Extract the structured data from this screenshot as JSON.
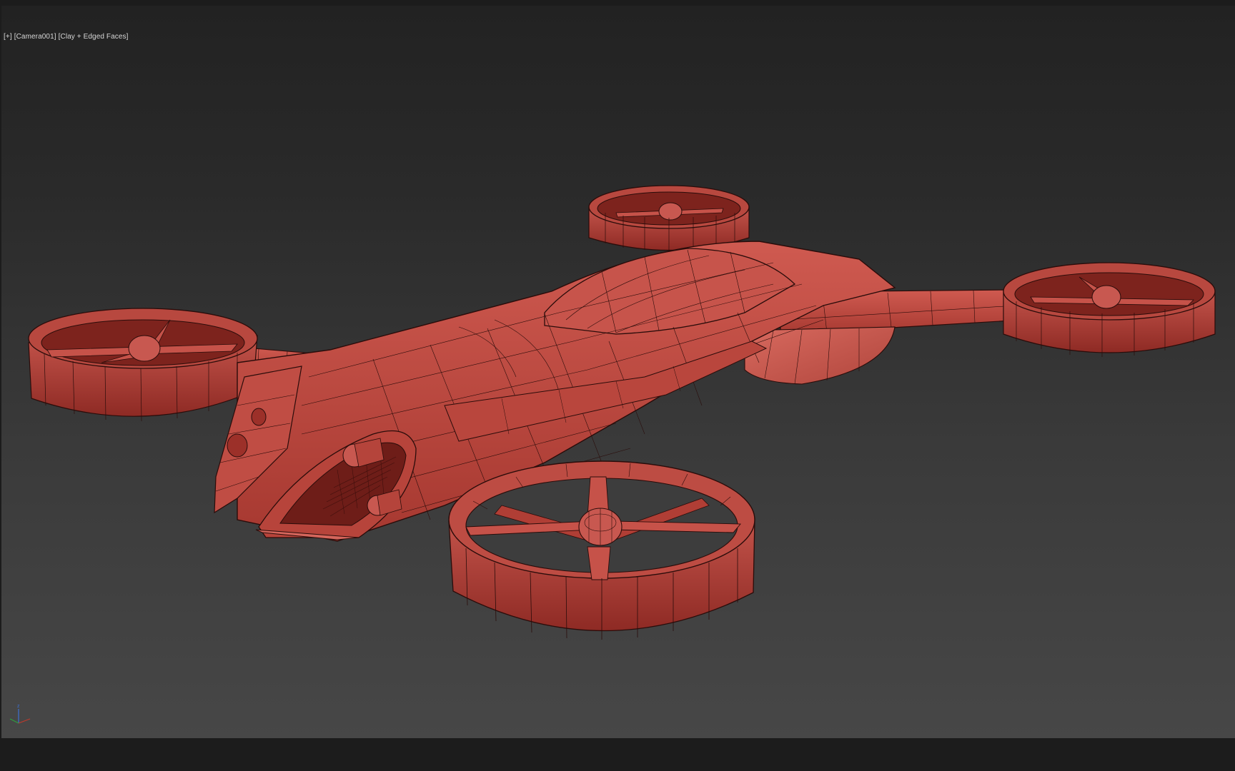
{
  "viewport": {
    "label_plus": "[+]",
    "label_camera": "[Camera001]",
    "label_shading": "[Clay + Edged Faces]"
  },
  "scene": {
    "object": "drone-model",
    "clay_color": "#b5433b",
    "wire_color": "#2a0c0a",
    "background_top": "#222222",
    "background_bottom": "#474747"
  },
  "gizmo": {
    "axis_z": "z",
    "x_color": "#c0392b",
    "y_color": "#2e9e3e",
    "z_color": "#3b6fd1"
  }
}
